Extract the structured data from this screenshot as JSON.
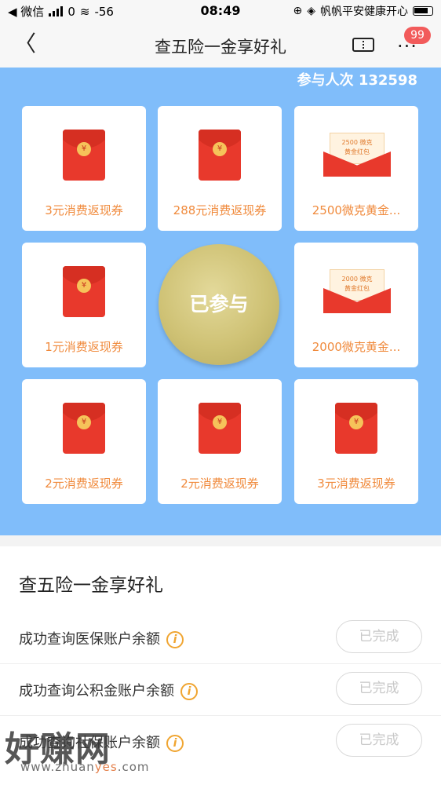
{
  "status_bar": {
    "carrier": "◀ 微信",
    "signal_value": "0",
    "net_speed": "-56",
    "time": "08:49",
    "right_text": "帆帆平安健康开心"
  },
  "nav": {
    "title": "查五险一金享好礼",
    "badge_count": "99"
  },
  "lottery": {
    "participants": "参与人次 132598",
    "draw_button_label": "已参与",
    "prizes": [
      {
        "label": "3元消费返现券",
        "icon": "red-packet"
      },
      {
        "label": "288元消费返现券",
        "icon": "red-packet"
      },
      {
        "label": "2500微克黄金...",
        "icon": "gold-packet",
        "paper_amount": "2500",
        "paper_unit": "微克",
        "paper_text": "黄金红包"
      },
      {
        "label": "1元消费返现券",
        "icon": "red-packet"
      },
      {
        "label": "2000微克黄金...",
        "icon": "gold-packet",
        "paper_amount": "2000",
        "paper_unit": "微克",
        "paper_text": "黄金红包"
      },
      {
        "label": "2元消费返现券",
        "icon": "red-packet"
      },
      {
        "label": "2元消费返现券",
        "icon": "red-packet"
      },
      {
        "label": "3元消费返现券",
        "icon": "red-packet"
      }
    ],
    "coin_glyph": "¥"
  },
  "tasks": {
    "title": "查五险一金享好礼",
    "items": [
      {
        "label": "成功查询医保账户余额",
        "status": "已完成"
      },
      {
        "label": "成功查询公积金账户余额",
        "status": "已完成"
      },
      {
        "label": "成功查询社保账户余额",
        "status": "已完成"
      }
    ]
  },
  "watermark": {
    "text": "好赚网",
    "url_prefix": "www.zhuan",
    "url_highlight": "yes",
    "url_suffix": ".com"
  },
  "colors": {
    "lottery_bg": "#80bdfa",
    "prize_text": "#f08a3c",
    "badge": "#f25b5b",
    "info_icon": "#f0a531"
  }
}
